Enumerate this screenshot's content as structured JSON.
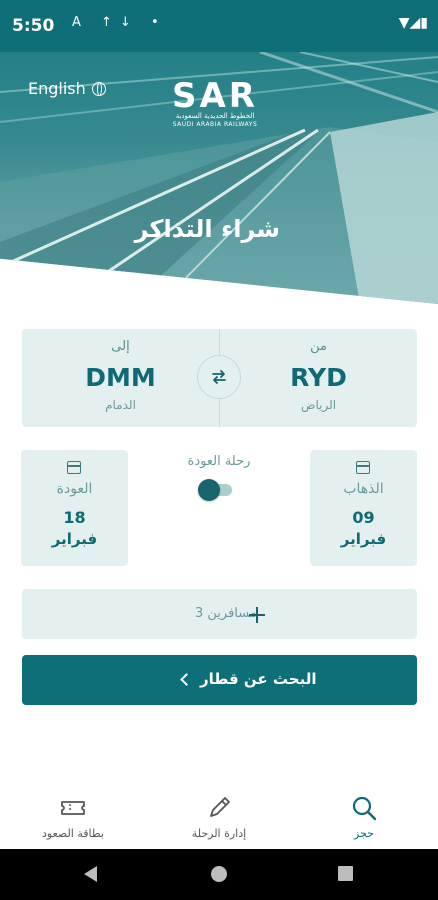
{
  "status_bar": {
    "time": "5:50",
    "left_icons": "A ↑↓ •",
    "right_icons": "▼◢▮"
  },
  "header": {
    "language_toggle": "English",
    "logo": {
      "main": "SAR",
      "sub_arabic": "الخطوط الحديدية السعودية",
      "sub_english": "SAUDI ARABIA RAILWAYS"
    },
    "title": "شراء التذاكر"
  },
  "route": {
    "from": {
      "label": "من",
      "code": "RYD",
      "name": "الرياض"
    },
    "to": {
      "label": "إلى",
      "code": "DMM",
      "name": "الدمام"
    },
    "swap_icon": "swap-arrows-icon"
  },
  "dates": {
    "depart": {
      "label": "الذهاب",
      "day": "09",
      "month": "فبراير"
    },
    "return": {
      "label": "العودة",
      "day": "18",
      "month": "فبراير"
    },
    "return_trip_label": "رحلة العودة",
    "return_trip_enabled": true
  },
  "passengers": {
    "label": "3 مسافرين"
  },
  "search_button": {
    "label": "البحث عن قطار"
  },
  "bottom_nav": {
    "items": [
      {
        "label": "حجز",
        "icon": "search-icon",
        "active": true
      },
      {
        "label": "إدارة الرحلة",
        "icon": "pencil-icon",
        "active": false
      },
      {
        "label": "بطاقة الصعود",
        "icon": "ticket-icon",
        "active": false
      }
    ]
  },
  "colors": {
    "primary": "#0f6f78",
    "card": "#e4f0f0",
    "text_muted": "#6b9a9c"
  }
}
